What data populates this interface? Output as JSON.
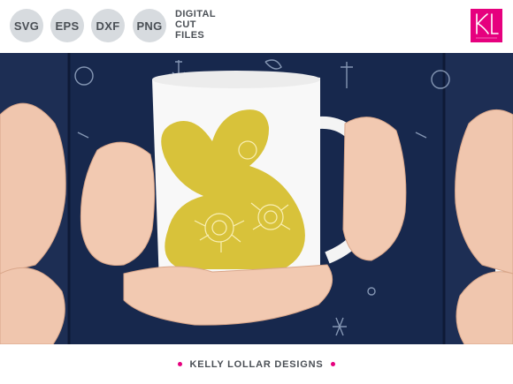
{
  "header": {
    "badges": [
      "SVG",
      "EPS",
      "DXF",
      "PNG"
    ],
    "label_lines": [
      "DIGITAL",
      "CUT",
      "FILES"
    ],
    "logo_text": "KL"
  },
  "footer": {
    "brand": "KELLY LOLLAR DESIGNS"
  },
  "colors": {
    "accent_pink": "#e6007e",
    "badge_bg": "#d7dbdf",
    "text_gray": "#4a4f55",
    "navy": "#16264a",
    "gold": "#d8c23a"
  }
}
